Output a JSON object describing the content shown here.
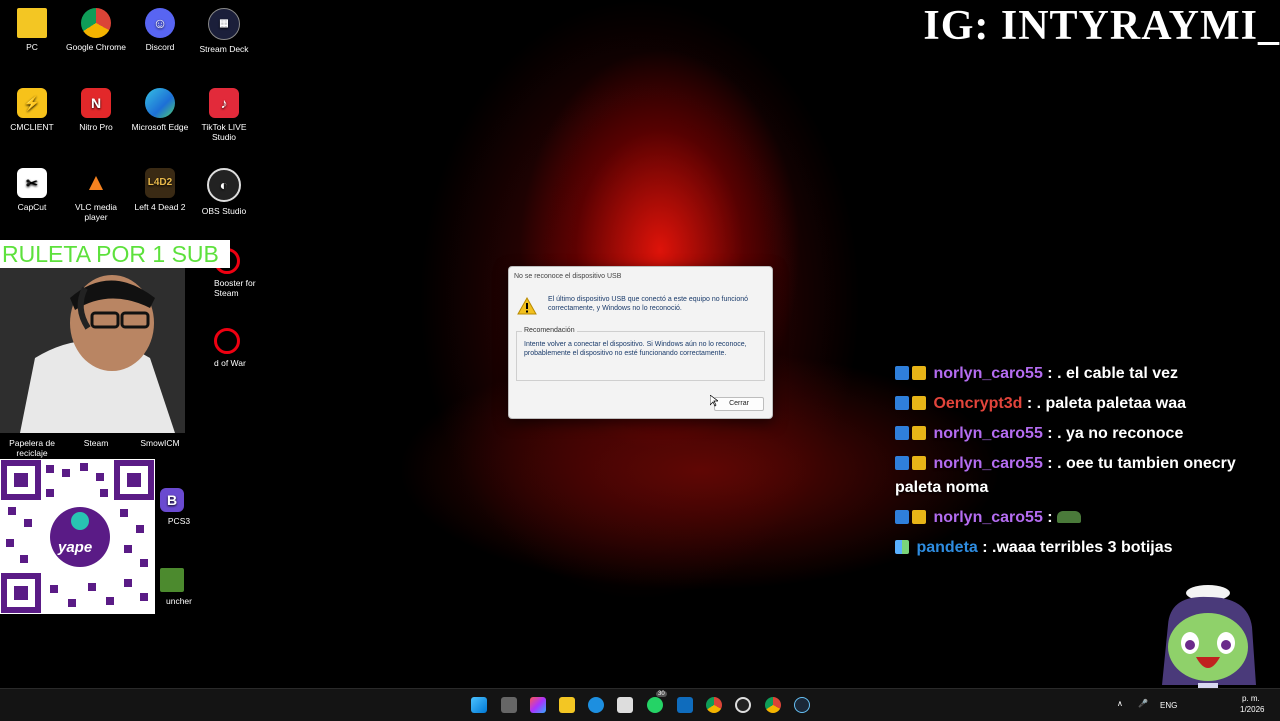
{
  "desktop": {
    "icons": [
      {
        "label": "PC"
      },
      {
        "label": "Google Chrome"
      },
      {
        "label": "Discord"
      },
      {
        "label": "Stream Deck"
      },
      {
        "label": "CMCLIENT"
      },
      {
        "label": "Nitro Pro"
      },
      {
        "label": "Microsoft Edge"
      },
      {
        "label": "TikTok LIVE Studio"
      },
      {
        "label": "CapCut"
      },
      {
        "label": "VLC media player"
      },
      {
        "label": "Left 4 Dead 2"
      },
      {
        "label": "OBS Studio"
      },
      {
        "label": "Booster for Steam"
      },
      {
        "label": "d of War"
      },
      {
        "label": "Papelera de reciclaje"
      },
      {
        "label": "Steam"
      },
      {
        "label": "SmowICM"
      },
      {
        "label": "PCS3"
      },
      {
        "label": "uncher"
      }
    ]
  },
  "overlay": {
    "ig": "IG: INTYRAYMI_",
    "ruleta": "RULETA POR 1 SUB",
    "qr_label": "yape"
  },
  "dialog": {
    "title": "No se reconoce el dispositivo USB",
    "message": "El último dispositivo USB que conectó a este equipo no funcionó correctamente, y Windows no lo reconoció.",
    "recommendation_label": "Recomendación",
    "recommendation": "Intente volver a conectar el dispositivo. Si Windows aún no lo reconoce, probablemente el dispositivo no esté funcionando correctamente.",
    "close_label": "Cerrar"
  },
  "chat": [
    {
      "user": "norlyn_caro55",
      "text": ": . el cable tal vez"
    },
    {
      "user": "Oencrypt3d",
      "text": ": . paleta paletaa waa"
    },
    {
      "user": "norlyn_caro55",
      "text": ": . ya no reconoce"
    },
    {
      "user": "norlyn_caro55",
      "text": ": . oee tu tambien onecry paleta noma"
    },
    {
      "user": "norlyn_caro55",
      "text": ":"
    },
    {
      "user": "pandeta",
      "text": ": .waaa terribles 3 botijas"
    }
  ],
  "taskbar": {
    "lang": "ENG",
    "time": "p. m.",
    "date": "1/2026",
    "badge_count": "30"
  }
}
